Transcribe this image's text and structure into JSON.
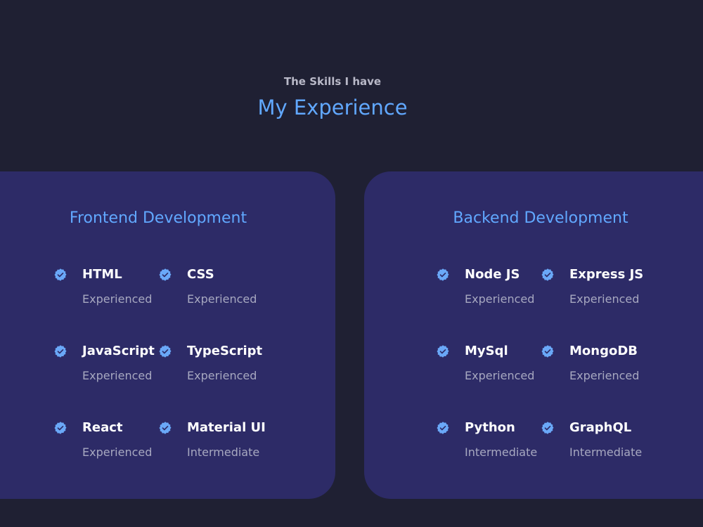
{
  "header": {
    "subtitle": "The Skills I have",
    "title": "My Experience"
  },
  "frontend": {
    "title": "Frontend Development",
    "skills": [
      {
        "name": "HTML",
        "level": "Experienced"
      },
      {
        "name": "CSS",
        "level": "Experienced"
      },
      {
        "name": "JavaScript",
        "level": "Experienced"
      },
      {
        "name": "TypeScript",
        "level": "Experienced"
      },
      {
        "name": "React",
        "level": "Experienced"
      },
      {
        "name": "Material UI",
        "level": "Intermediate"
      }
    ]
  },
  "backend": {
    "title": "Backend Development",
    "skills": [
      {
        "name": "Node JS",
        "level": "Experienced"
      },
      {
        "name": "Express JS",
        "level": "Experienced"
      },
      {
        "name": "MySql",
        "level": "Experienced"
      },
      {
        "name": "MongoDB",
        "level": "Experienced"
      },
      {
        "name": "Python",
        "level": "Intermediate"
      },
      {
        "name": "GraphQL",
        "level": "Intermediate"
      }
    ]
  },
  "icons": {
    "skill_badge": "verified-badge-icon"
  },
  "colors": {
    "background": "#1f2033",
    "card": "#2d2b67",
    "accent": "#61a8ff",
    "text_primary": "#ffffff",
    "text_secondary": "#a7a8c0"
  }
}
